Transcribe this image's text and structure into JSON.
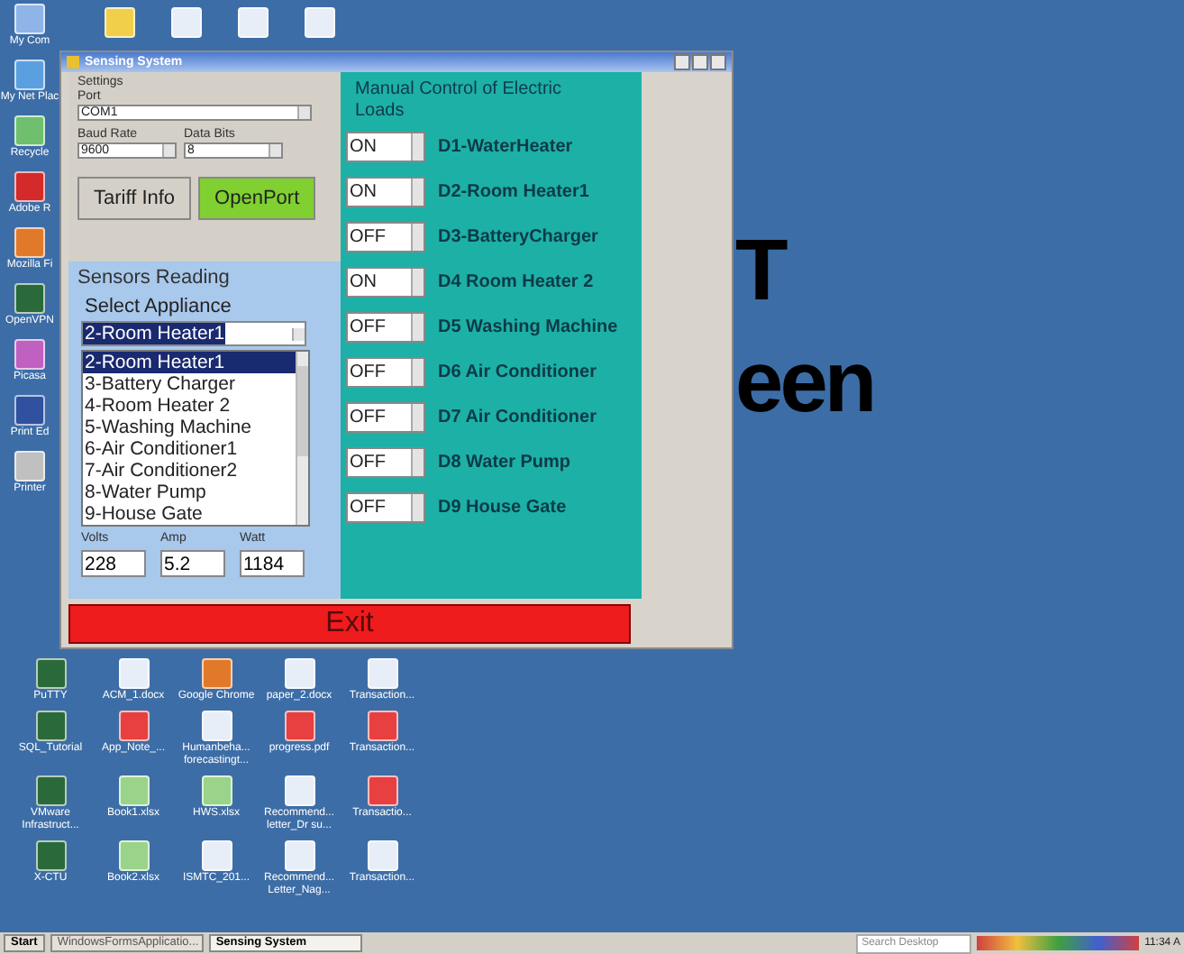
{
  "desktop": {
    "left_column": [
      {
        "kind": "computer",
        "label": "My Com"
      },
      {
        "kind": "network",
        "label": "My Net Plac"
      },
      {
        "kind": "recycle",
        "label": "Recycle"
      },
      {
        "kind": "pdfapp",
        "label": "Adobe R"
      },
      {
        "kind": "browser",
        "label": "Mozilla Fi"
      },
      {
        "kind": "app",
        "label": "OpenVPN"
      },
      {
        "kind": "photo",
        "label": "Picasa"
      },
      {
        "kind": "info",
        "label": "Print Ed"
      },
      {
        "kind": "printer",
        "label": "Printer"
      }
    ],
    "top_row": [
      {
        "kind": "folder"
      },
      {
        "kind": "doc"
      },
      {
        "kind": "doc"
      },
      {
        "kind": "doc"
      }
    ],
    "bottom_rows": [
      [
        {
          "kind": "app",
          "label": "PuTTY"
        },
        {
          "kind": "doc",
          "label": "ACM_1.docx"
        },
        {
          "kind": "browser",
          "label": "Google Chrome"
        },
        {
          "kind": "doc",
          "label": "paper_2.docx"
        },
        {
          "kind": "doc",
          "label": "Transaction..."
        }
      ],
      [
        {
          "kind": "app",
          "label": "SQL_Tutorial"
        },
        {
          "kind": "pdf",
          "label": "App_Note_..."
        },
        {
          "kind": "doc",
          "label": "Humanbeha... forecastingt..."
        },
        {
          "kind": "pdf",
          "label": "progress.pdf"
        },
        {
          "kind": "pdf",
          "label": "Transaction..."
        }
      ],
      [
        {
          "kind": "app",
          "label": "VMware Infrastruct..."
        },
        {
          "kind": "xls",
          "label": "Book1.xlsx"
        },
        {
          "kind": "xls",
          "label": "HWS.xlsx"
        },
        {
          "kind": "doc",
          "label": "Recommend... letter_Dr su..."
        },
        {
          "kind": "pdf",
          "label": "Transactio..."
        }
      ],
      [
        {
          "kind": "app",
          "label": "X-CTU"
        },
        {
          "kind": "xls",
          "label": "Book2.xlsx"
        },
        {
          "kind": "doc",
          "label": "ISMTC_201..."
        },
        {
          "kind": "doc",
          "label": "Recommend... Letter_Nag..."
        },
        {
          "kind": "doc",
          "label": "Transaction..."
        }
      ]
    ],
    "wallpaper_text": [
      "T",
      "een"
    ]
  },
  "window": {
    "title": "Sensing System",
    "settings": {
      "title": "Settings",
      "port_label": "Port",
      "port": "COM1",
      "baud_label": "Baud Rate",
      "baud": "9600",
      "bits_label": "Data Bits",
      "bits": "8",
      "buttons": [
        "Tariff Info",
        "OpenPort"
      ]
    },
    "sensors": {
      "title": "Sensors Reading",
      "select_label": "Select Appliance",
      "selected": "2-Room Heater1",
      "list": [
        {
          "label": "2-Room Heater1",
          "selected": true
        },
        {
          "label": "3-Battery Charger",
          "selected": false
        },
        {
          "label": "4-Room Heater 2",
          "selected": false
        },
        {
          "label": "5-Washing Machine",
          "selected": false
        },
        {
          "label": "6-Air Conditioner1",
          "selected": false
        },
        {
          "label": "7-Air Conditioner2",
          "selected": false
        },
        {
          "label": "8-Water Pump",
          "selected": false
        },
        {
          "label": "9-House Gate",
          "selected": false
        }
      ],
      "readings": [
        {
          "label": "Volts",
          "value": "228"
        },
        {
          "label": "Amp",
          "value": "5.2"
        },
        {
          "label": "Watt",
          "value": "1184"
        }
      ]
    },
    "manual": {
      "title": "Manual Control of Electric Loads",
      "loads": [
        {
          "state": "ON",
          "name": "D1-WaterHeater"
        },
        {
          "state": "ON",
          "name": "D2-Room Heater1"
        },
        {
          "state": "OFF",
          "name": "D3-BatteryCharger"
        },
        {
          "state": "ON",
          "name": "D4  Room Heater 2"
        },
        {
          "state": "OFF",
          "name": "D5  Washing Machine"
        },
        {
          "state": "OFF",
          "name": "D6 Air Conditioner"
        },
        {
          "state": "OFF",
          "name": "D7 Air Conditioner"
        },
        {
          "state": "OFF",
          "name": "D8 Water Pump"
        },
        {
          "state": "OFF",
          "name": "D9 House Gate"
        }
      ]
    },
    "exit": "Exit"
  },
  "taskbar": {
    "start": "Start",
    "tasks": [
      {
        "label": "WindowsFormsApplicatio...",
        "selected": false
      },
      {
        "label": "Sensing System",
        "selected": true
      }
    ],
    "search": "Search Desktop",
    "clock": "11:34 A"
  }
}
